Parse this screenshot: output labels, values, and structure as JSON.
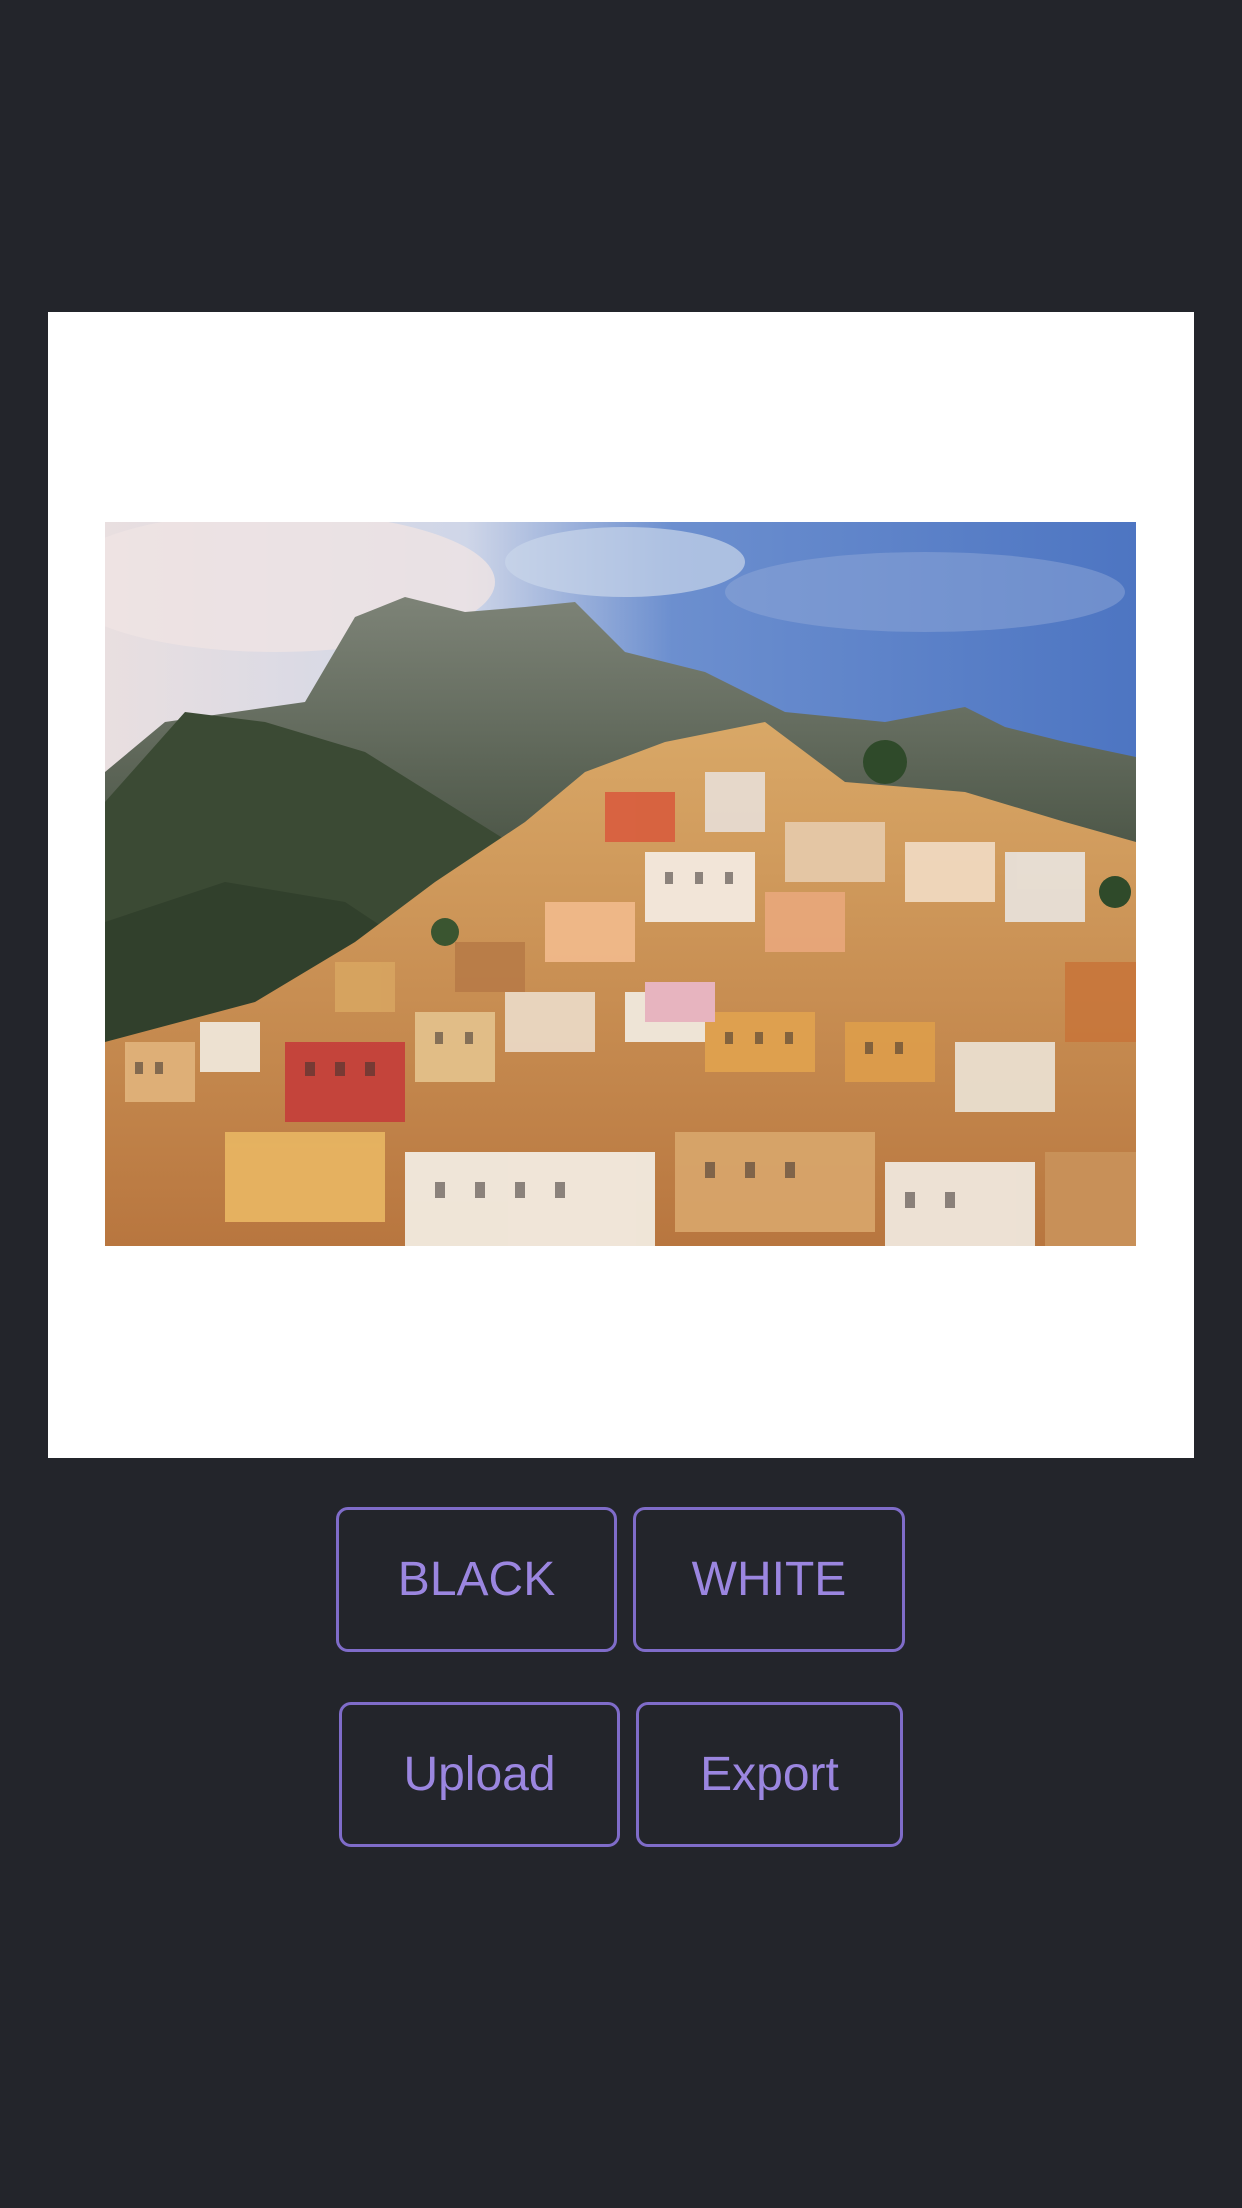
{
  "canvas": {
    "background_color": "#ffffff",
    "image_description_icon": "photo-hillside-village"
  },
  "buttons": {
    "black_label": "BLACK",
    "white_label": "WHITE",
    "upload_label": "Upload",
    "export_label": "Export"
  },
  "colors": {
    "page_background": "#23252b",
    "accent": "#9b86e0",
    "button_border": "#7f6cc9"
  }
}
